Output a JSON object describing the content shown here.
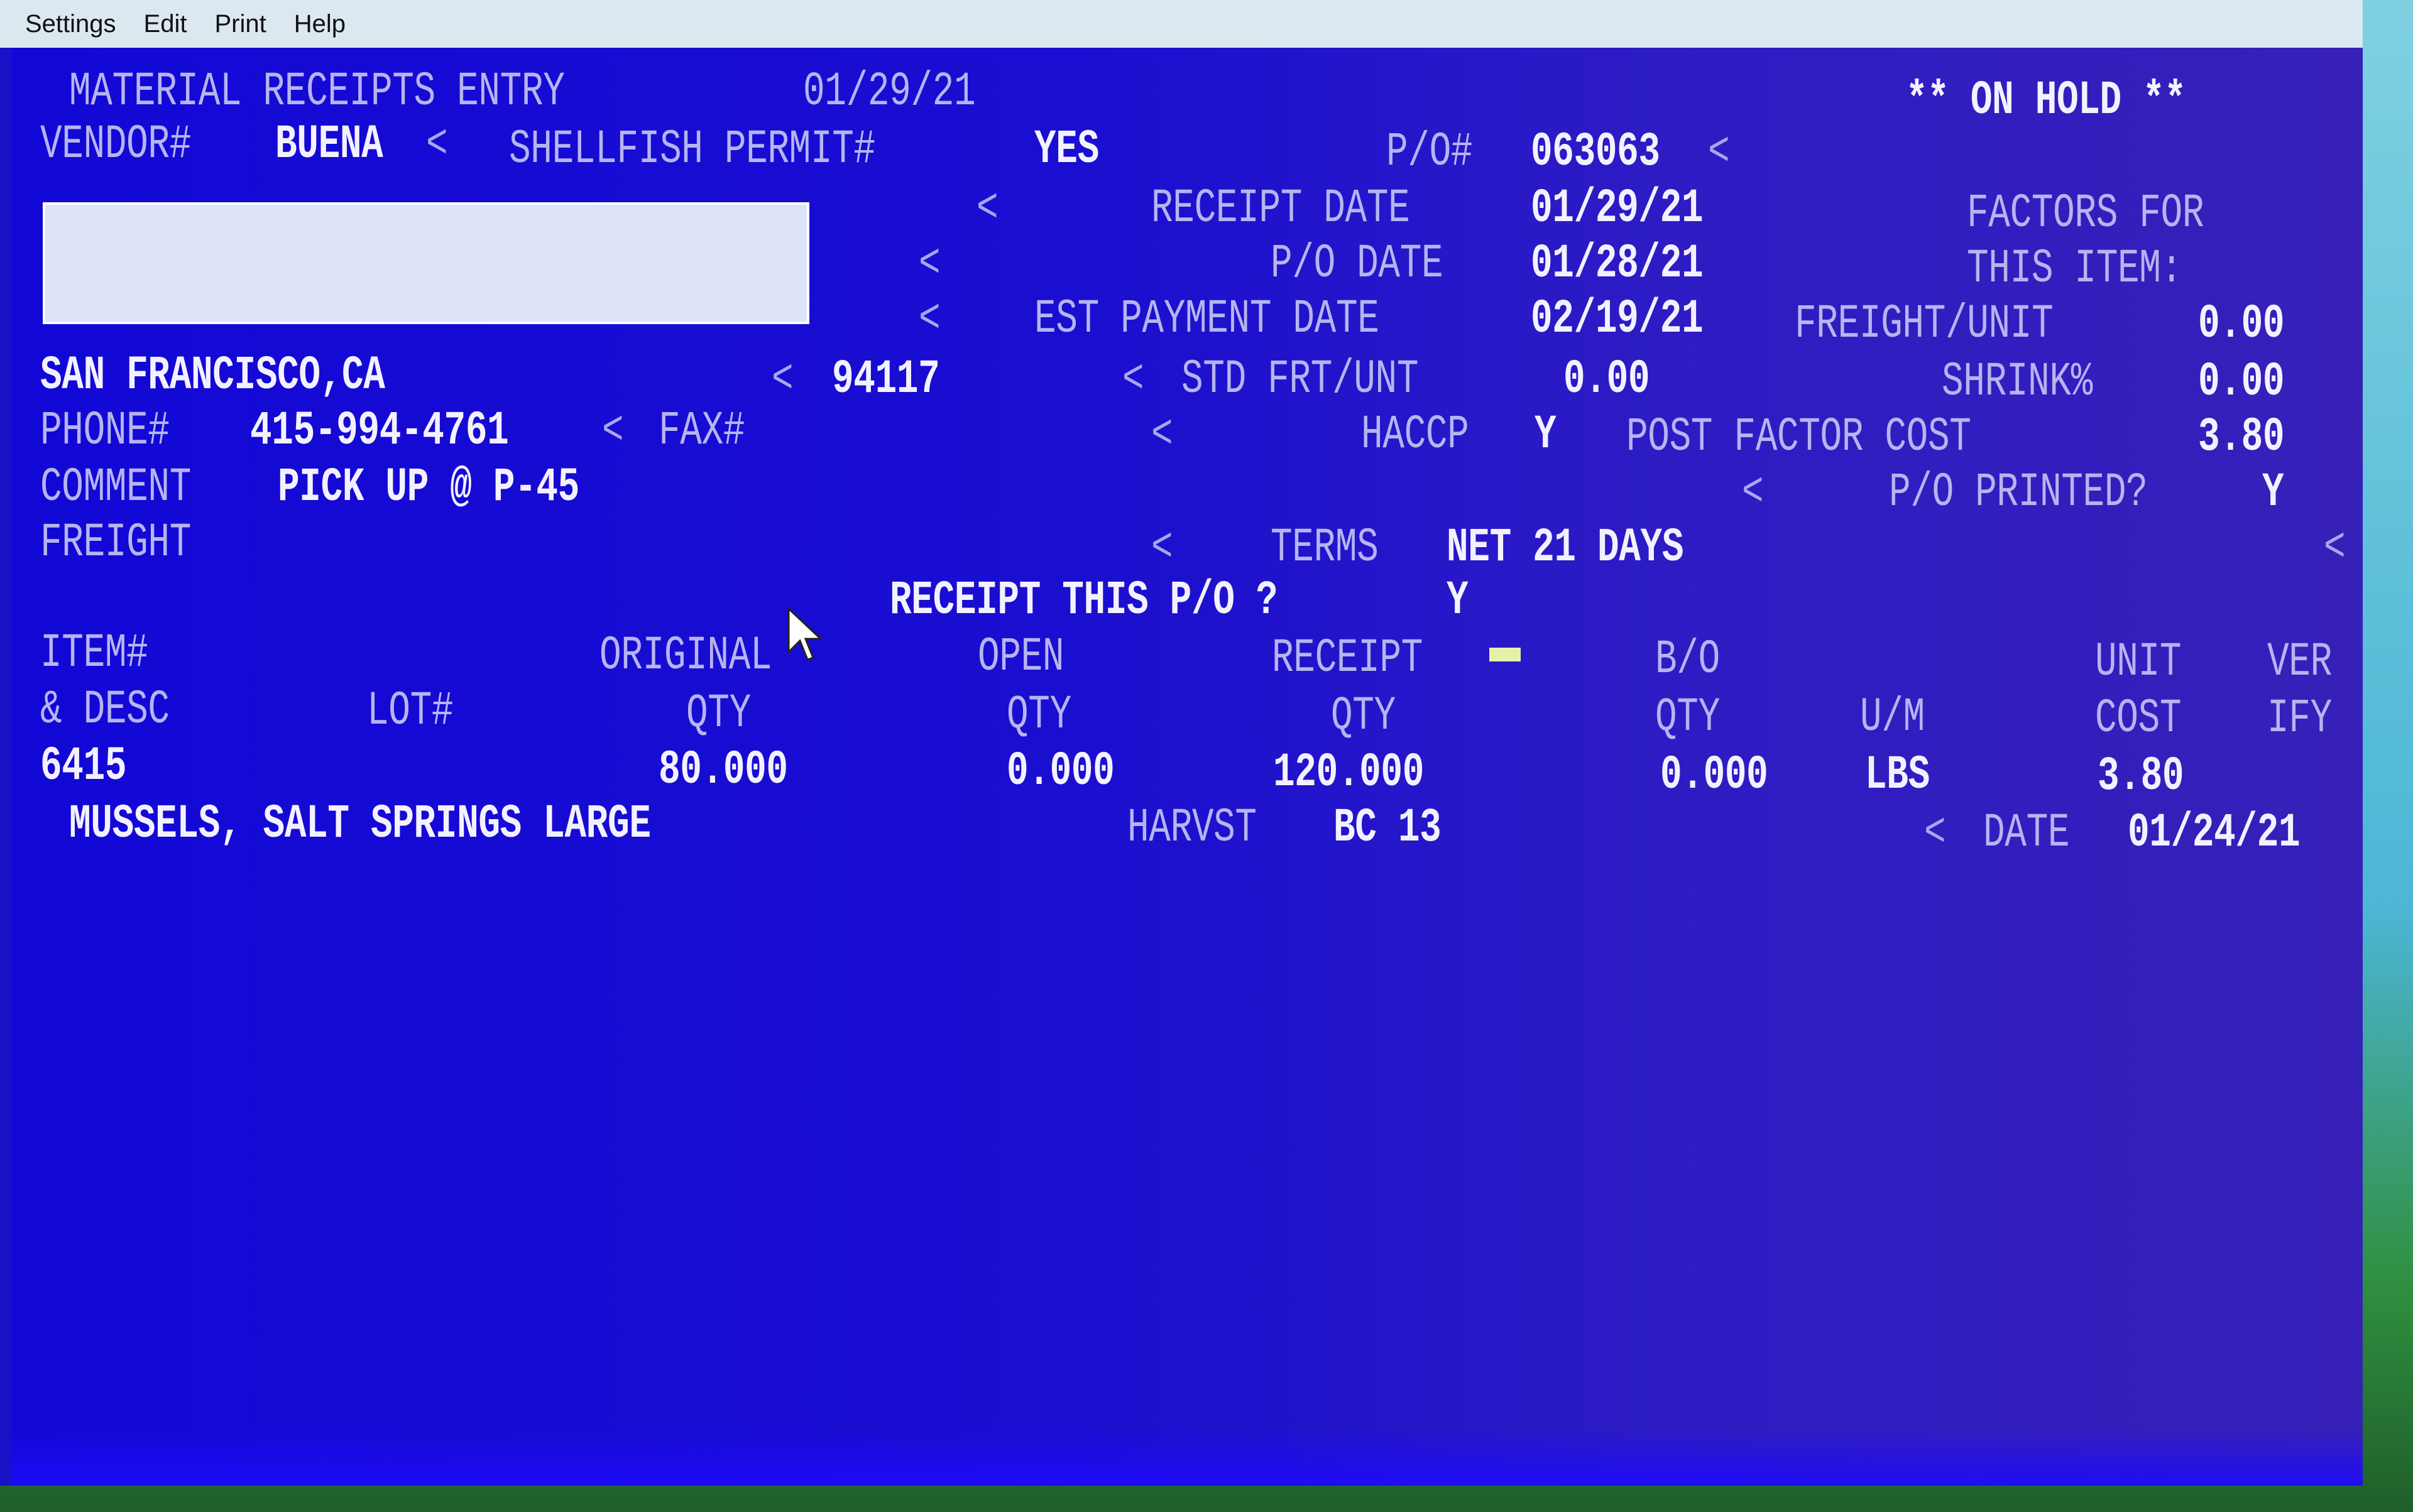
{
  "menubar": {
    "items": [
      "Settings",
      "Edit",
      "Print",
      "Help"
    ]
  },
  "header": {
    "title": "MATERIAL RECEIPTS ENTRY",
    "date": "01/29/21",
    "status": "** ON HOLD **"
  },
  "vendor": {
    "label": "VENDOR#",
    "value": "BUENA",
    "shellfish_label": "SHELLFISH PERMIT#",
    "shellfish_value": "YES",
    "city": "SAN FRANCISCO,CA",
    "zip": "94117",
    "phone_label": "PHONE#",
    "phone_value": "415-994-4761",
    "fax_label": "FAX#",
    "fax_value": "",
    "comment_label": "COMMENT",
    "comment_value": "PICK UP @ P-45",
    "freight_label": "FREIGHT",
    "freight_value": ""
  },
  "po": {
    "po_label": "P/O#",
    "po_value": "063063",
    "receipt_date_label": "RECEIPT DATE",
    "receipt_date_value": "01/29/21",
    "po_date_label": "P/O DATE",
    "po_date_value": "01/28/21",
    "est_payment_label": "EST PAYMENT DATE",
    "est_payment_value": "02/19/21",
    "std_frt_label": "STD FRT/UNT",
    "std_frt_value": "0.00",
    "haccp_label": "HACCP",
    "haccp_value": "Y",
    "po_printed_label": "P/O PRINTED?",
    "po_printed_value": "Y",
    "terms_label": "TERMS",
    "terms_value": "NET 21 DAYS"
  },
  "factors": {
    "title_line1": "FACTORS FOR",
    "title_line2": "THIS ITEM:",
    "freight_unit_label": "FREIGHT/UNIT",
    "freight_unit_value": "0.00",
    "shrink_label": "SHRINK%",
    "shrink_value": "0.00",
    "post_factor_label": "POST FACTOR COST",
    "post_factor_value": "3.80"
  },
  "prompt": {
    "question": "RECEIPT THIS P/O ?",
    "answer": "Y"
  },
  "table": {
    "headers_row1": {
      "item": "ITEM#",
      "original": "ORIGINAL",
      "open": "OPEN",
      "receipt": "RECEIPT",
      "bo": "B/O",
      "unit": "UNIT",
      "ver": "VER"
    },
    "headers_row2": {
      "desc": "& DESC",
      "lot": "LOT#",
      "original": "QTY",
      "open": "QTY",
      "receipt": "QTY",
      "bo": "QTY",
      "um": "U/M",
      "unit": "COST",
      "ver": "IFY"
    },
    "rows": [
      {
        "item": "6415",
        "lot": "",
        "original_qty": "80.000",
        "open_qty": "0.000",
        "receipt_qty": "120.000",
        "bo_qty": "0.000",
        "um": "LBS",
        "unit_cost": "3.80",
        "description": "MUSSELS, SALT SPRINGS LARGE",
        "harvest_label": "HARVST",
        "harvest_value": "BC 13",
        "date_label": "DATE",
        "date_value": "01/24/21"
      }
    ]
  },
  "markers": {
    "field_marker": "<"
  }
}
